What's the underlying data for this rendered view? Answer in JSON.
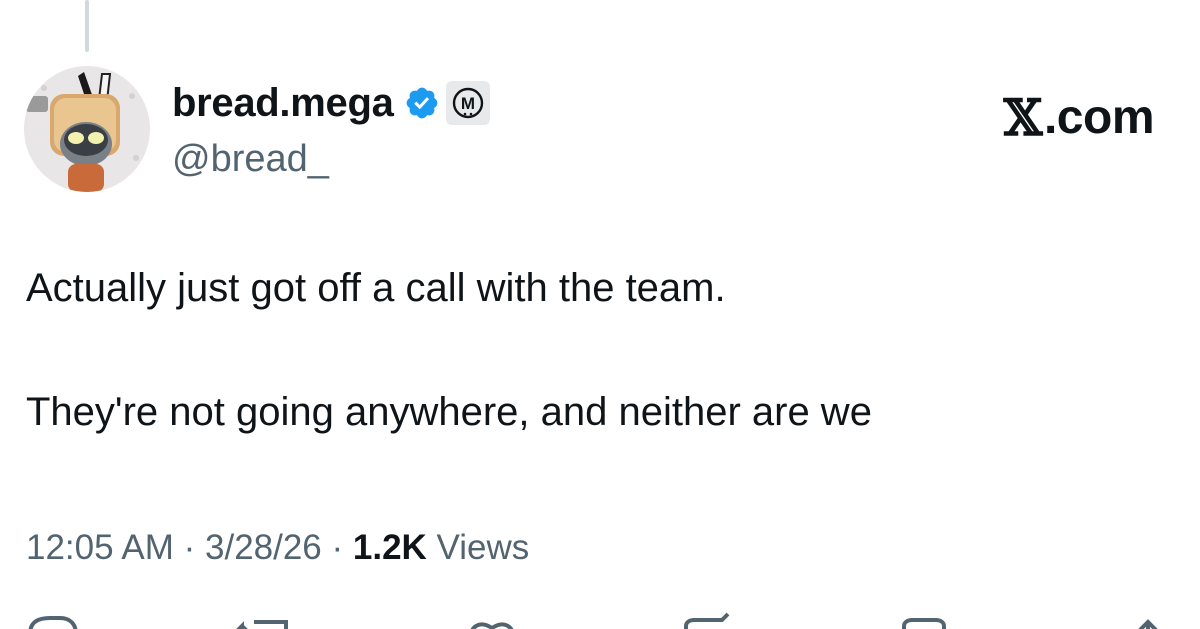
{
  "brand": {
    "label": ".com",
    "glyph": "𝕏"
  },
  "author": {
    "display_name": "bread.mega",
    "handle": "@bread_",
    "verified_icon": "verified-badge-icon",
    "affiliate_badge_letter": "M",
    "avatar": "avatar-image"
  },
  "tweet": {
    "line1": "Actually just got off a call with the team.",
    "line2": "They're not going anywhere, and neither are we"
  },
  "meta": {
    "time": "12:05 AM",
    "sep1": " · ",
    "date": "3/28/26",
    "sep2": " · ",
    "views_count": "1.2K",
    "views_label": " Views"
  },
  "actions": [
    {
      "name": "reply-icon"
    },
    {
      "name": "retweet-icon"
    },
    {
      "name": "like-icon"
    },
    {
      "name": "bookmark-icon"
    },
    {
      "name": "share-icon"
    }
  ],
  "colors": {
    "text": "#0f1419",
    "secondary": "#536471",
    "verified": "#1d9bf0",
    "thread_line": "#cfd9de"
  }
}
